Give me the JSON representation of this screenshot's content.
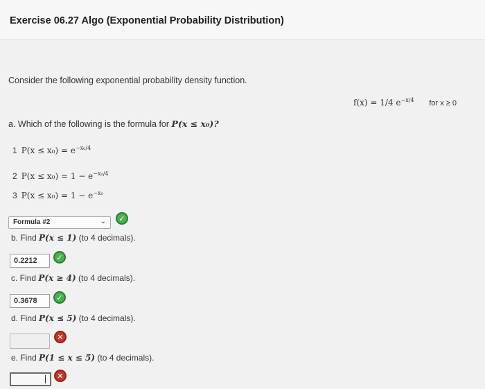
{
  "header": {
    "title": "Exercise 06.27 Algo (Exponential Probability Distribution)"
  },
  "prompt": "Consider the following exponential probability density function.",
  "density": {
    "lhs": "f(x) =",
    "coef": "1/4",
    "base": "e",
    "exponent": "−x/4",
    "condition": "for x ≥ 0"
  },
  "part_a": {
    "question_prefix": "a. Which of the following is the formula for",
    "question_math": "P(x ≤ x₀)?",
    "options": [
      {
        "num": "1",
        "lhs": "P(x ≤ x₀) = e",
        "exp": "−x₀/4"
      },
      {
        "num": "2",
        "lhs": "P(x ≤ x₀) = 1 − e",
        "exp": "−x₀/4"
      },
      {
        "num": "3",
        "lhs": "P(x ≤ x₀) = 1 − e",
        "exp": "−x₀"
      }
    ],
    "selected": "Formula #2"
  },
  "part_b": {
    "prefix": "b. Find",
    "math": "P(x ≤ 1)",
    "suffix": "(to 4 decimals).",
    "answer": "0.2212"
  },
  "part_c": {
    "prefix": "c. Find",
    "math": "P(x ≥ 4)",
    "suffix": "(to 4 decimals).",
    "answer": "0.3678"
  },
  "part_d": {
    "prefix": "d. Find",
    "math": "P(x ≤ 5)",
    "suffix": "(to 4 decimals).",
    "answer": ""
  },
  "part_e": {
    "prefix": "e. Find",
    "math": "P(1 ≤ x ≤ 5)",
    "suffix": "(to 4 decimals).",
    "answer": ""
  },
  "icons": {
    "correct": "check-icon",
    "incorrect": "cross-icon"
  },
  "colors": {
    "correct": "#4caf50",
    "incorrect": "#c0392b"
  }
}
